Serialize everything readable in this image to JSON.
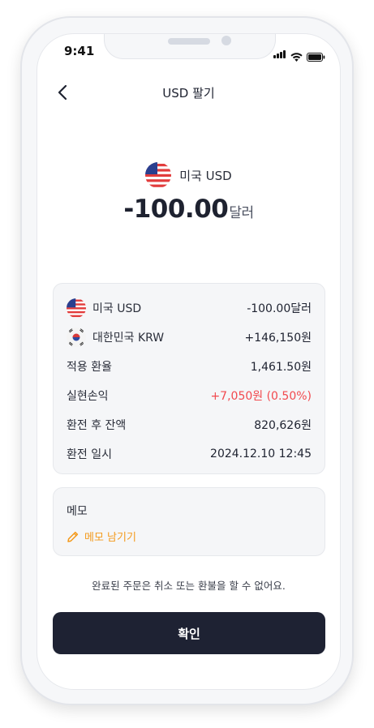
{
  "status_bar": {
    "time": "9:41"
  },
  "nav": {
    "title": "USD 팔기"
  },
  "hero": {
    "currency_label": "미국 USD",
    "amount": "-100.00",
    "unit": "달러"
  },
  "details": [
    {
      "label": "미국 USD",
      "value": "-100.00달러",
      "icon": "us-flag-icon"
    },
    {
      "label": "대한민국 KRW",
      "value": "+146,150원",
      "icon": "kr-flag-icon"
    },
    {
      "label": "적용 환율",
      "value": "1,461.50원"
    },
    {
      "label": "실현손익",
      "value": "+7,050원 (0.50%)",
      "accent": "#f2494e"
    },
    {
      "label": "환전 후 잔액",
      "value": "820,626원"
    },
    {
      "label": "환전 일시",
      "value": "2024.12.10 12:45"
    }
  ],
  "memo": {
    "label": "메모",
    "action": "메모 남기기",
    "accent": "#f49a1c"
  },
  "notice": "완료된 주문은 취소 또는 환불을 할 수 없어요.",
  "confirm_label": "확인",
  "colors": {
    "button_bg": "#1e2233",
    "profit": "#f2494e",
    "memo_link": "#f49a1c"
  }
}
